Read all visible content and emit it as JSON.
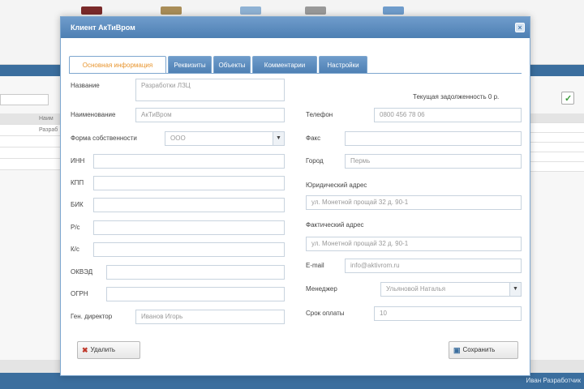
{
  "dialog": {
    "title": "Клиент АкТиВром",
    "tabs": [
      {
        "label": "Основная информация",
        "active": true
      },
      {
        "label": "Реквизиты",
        "active": false
      },
      {
        "label": "Объекты",
        "active": false
      },
      {
        "label": "Комментарии",
        "active": false
      },
      {
        "label": "Настройки",
        "active": false
      }
    ],
    "left": [
      {
        "key": "name",
        "label": "Название",
        "value": "Разработки ЛЗЦ",
        "placeholder": ""
      },
      {
        "key": "short_name",
        "label": "Наименование",
        "value": "АкТиВром",
        "placeholder": ""
      },
      {
        "key": "tax_form",
        "label": "Форма собственности",
        "value": "ООО",
        "placeholder": ""
      },
      {
        "key": "inn",
        "label": "ИНН",
        "value": "",
        "placeholder": ""
      },
      {
        "key": "kpp",
        "label": "КПП",
        "value": "",
        "placeholder": ""
      },
      {
        "key": "bik",
        "label": "БИК",
        "value": "",
        "placeholder": ""
      },
      {
        "key": "rs",
        "label": "Р/с",
        "value": "",
        "placeholder": ""
      },
      {
        "key": "ks",
        "label": "К/с",
        "value": "",
        "placeholder": ""
      },
      {
        "key": "okved",
        "label": "ОКВЭД",
        "value": "",
        "placeholder": ""
      },
      {
        "key": "ogrn",
        "label": "ОГРН",
        "value": "",
        "placeholder": ""
      },
      {
        "key": "director",
        "label": "Ген. директор",
        "value": "",
        "placeholder": "Иванов Игорь"
      }
    ],
    "balance_label": "Текущая задолженность 0 р.",
    "right": [
      {
        "key": "phone",
        "label": "Телефон",
        "value": "0800 456 78 06"
      },
      {
        "key": "fax",
        "label": "Факс",
        "value": ""
      },
      {
        "key": "city",
        "label": "Город",
        "value": "Пермь"
      },
      {
        "key": "legal_address",
        "label": "Юридический адрес",
        "value": "ул. Монетной прощай 32 д. 90-1"
      },
      {
        "key": "postal_address",
        "label": "Фактический адрес",
        "value": "ул. Монетной прощай 32 д. 90-1"
      },
      {
        "key": "email",
        "label": "E-mail",
        "value": "info@aktivrom.ru"
      },
      {
        "key": "manager",
        "label": "Менеджер",
        "value": "Ульяновой Наталья"
      },
      {
        "key": "payment_term",
        "label": "Срок оплаты",
        "value": "10"
      }
    ],
    "buttons": {
      "cancel": "Удалить",
      "save": "Сохранить"
    }
  },
  "background": {
    "status_text": "Иван Разработчик",
    "grid_rows": [
      "Наим",
      "Разраб",
      "",
      "",
      ""
    ]
  },
  "colors": {
    "accent": "#4d7fb3",
    "active_tab_text": "#e8952f",
    "status_bar": "#3b6e9e"
  },
  "icons": {
    "close": "close-icon",
    "cancel": "delete-icon",
    "save": "save-icon",
    "check": "check-icon"
  }
}
